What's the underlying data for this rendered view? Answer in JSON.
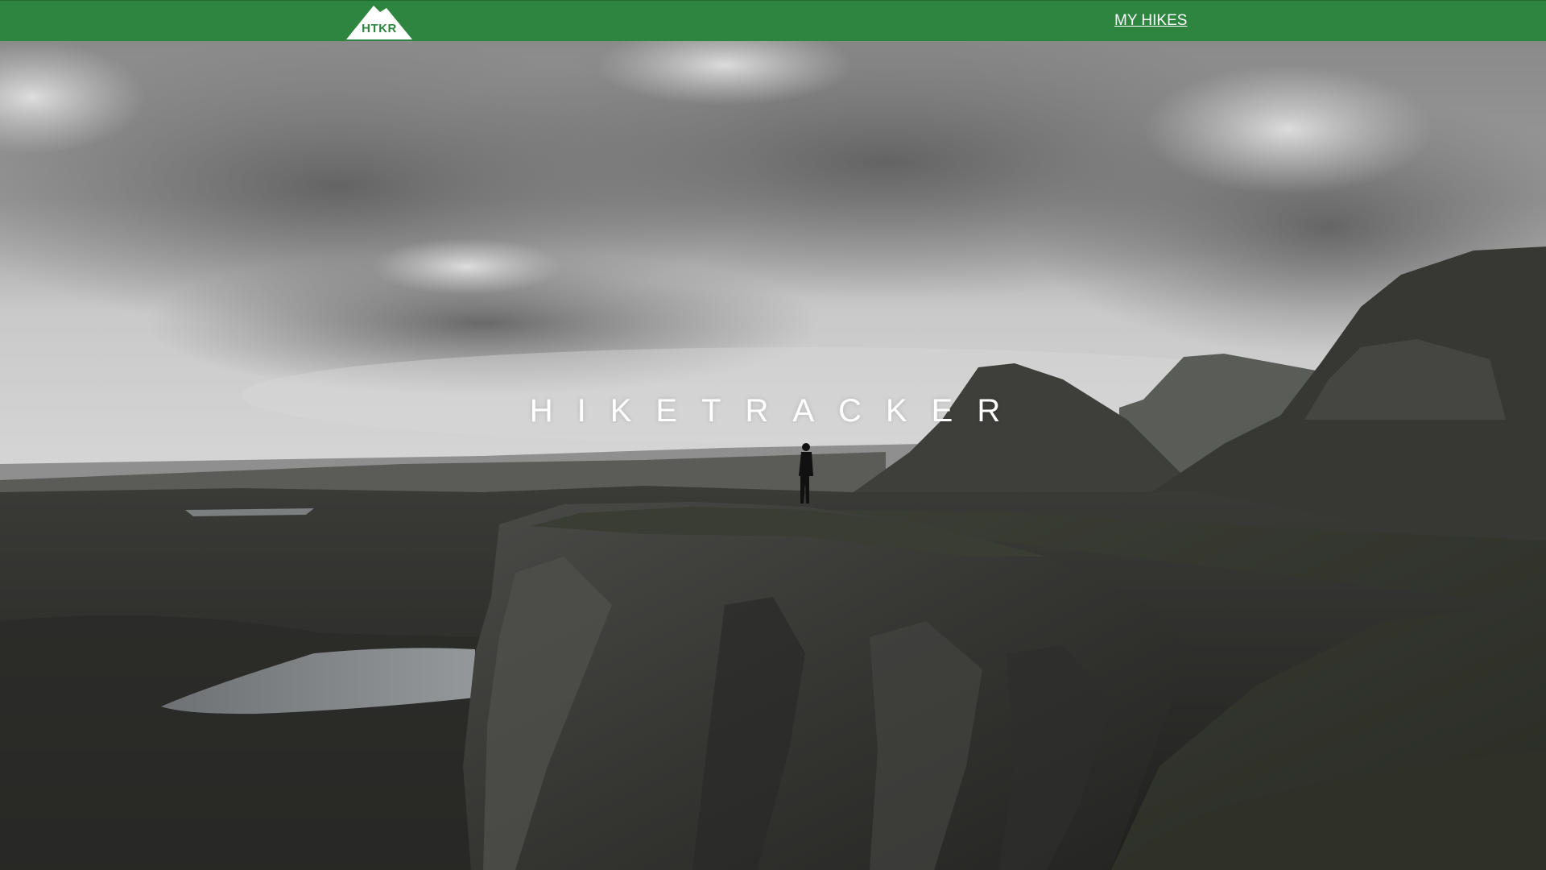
{
  "navbar": {
    "logo_text": "HTKR",
    "links": [
      {
        "label": "MY HIKES"
      }
    ]
  },
  "hero": {
    "title": "HIKETRACKER"
  },
  "colors": {
    "nav_background": "#2e8540",
    "logo_mountain": "#ffffff",
    "title_text": "#ffffff"
  }
}
